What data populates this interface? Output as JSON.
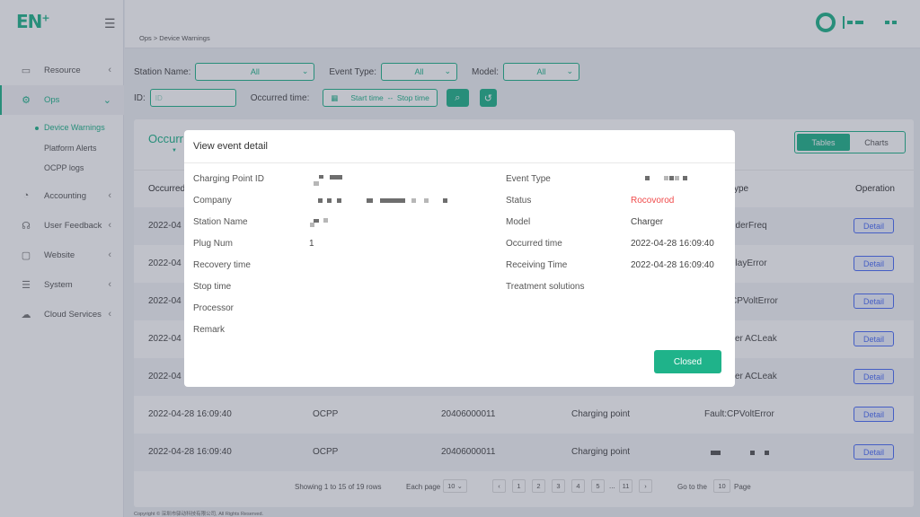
{
  "app": {
    "logo": "EN",
    "logo_sup": "+"
  },
  "breadcrumb": "Ops > Device Warnings",
  "sidebar": {
    "items": [
      {
        "label": "Resource",
        "icon": "resource-icon"
      },
      {
        "label": "Ops",
        "icon": "ops-icon"
      },
      {
        "label": "Accounting",
        "icon": "accounting-icon"
      },
      {
        "label": "User Feedback",
        "icon": "feedback-icon"
      },
      {
        "label": "Website",
        "icon": "website-icon"
      },
      {
        "label": "System",
        "icon": "system-icon"
      },
      {
        "label": "Cloud Services",
        "icon": "cloud-icon"
      }
    ],
    "ops_sub": [
      {
        "label": "Device Warnings"
      },
      {
        "label": "Platform Alerts"
      },
      {
        "label": "OCPP logs"
      }
    ]
  },
  "filters": {
    "station_label": "Station Name:",
    "station_value": "All",
    "event_label": "Event Type:",
    "event_value": "All",
    "model_label": "Model:",
    "model_value": "All",
    "id_label": "ID:",
    "id_placeholder": "ID",
    "time_label": "Occurred time:",
    "start": "Start time",
    "sep": "--",
    "stop": "Stop time"
  },
  "panel": {
    "title": "Occurr",
    "view_tables": "Tables",
    "view_charts": "Charts",
    "headers": {
      "occurred": "Occurred",
      "type": "ype",
      "operation": "Operation"
    },
    "detail_label": "Detail",
    "rows": [
      {
        "c1": "2022-04",
        "c5": "nderFreq"
      },
      {
        "c1": "2022-04",
        "c5": "elayError"
      },
      {
        "c1": "2022-04",
        "c5": "CPVoltError"
      },
      {
        "c1": "2022-04",
        "c5": "ver ACLeak"
      },
      {
        "c1": "2022-04",
        "c5": "ver ACLeak"
      },
      {
        "c1": "2022-04-28 16:09:40",
        "c2": "OCPP",
        "c3": "20406000011",
        "c4": "Charging point",
        "c5": "Fault:CPVoltError"
      },
      {
        "c1": "2022-04-28 16:09:40",
        "c2": "OCPP",
        "c3": "20406000011",
        "c4": "Charging point",
        "c5": ""
      }
    ],
    "pager": {
      "showing": "Showing 1 to 15 of 19 rows",
      "each_page": "Each page",
      "each_value": "10",
      "pages": [
        "1",
        "2",
        "3",
        "4",
        "5",
        "...",
        "11"
      ],
      "goto": "Go to the",
      "goto_value": "10",
      "page": "Page"
    }
  },
  "copyright": "Copyright © 深圳市驿动科技有限公司, All Rights Reserved.",
  "modal": {
    "title": "View event detail",
    "left": [
      {
        "label": "Charging Point ID",
        "value": ""
      },
      {
        "label": "Company",
        "value": ""
      },
      {
        "label": "Station Name",
        "value": ""
      },
      {
        "label": "Plug Num",
        "value": "1"
      },
      {
        "label": "Recovery time",
        "value": ""
      },
      {
        "label": "Stop time",
        "value": ""
      },
      {
        "label": "Processor",
        "value": ""
      },
      {
        "label": "Remark",
        "value": ""
      }
    ],
    "right": [
      {
        "label": "Event Type",
        "value": ""
      },
      {
        "label": "Status",
        "value": "Rocovorod"
      },
      {
        "label": "Model",
        "value": "Charger"
      },
      {
        "label": "Occurred time",
        "value": "2022-04-28 16:09:40"
      },
      {
        "label": "Receiving Time",
        "value": "2022-04-28 16:09:40"
      },
      {
        "label": "Treatment solutions",
        "value": ""
      }
    ],
    "close_label": "Closed"
  },
  "colors": {
    "accent": "#1fb38a",
    "status_red": "#f04b4b",
    "link_blue": "#4a6cf7"
  }
}
